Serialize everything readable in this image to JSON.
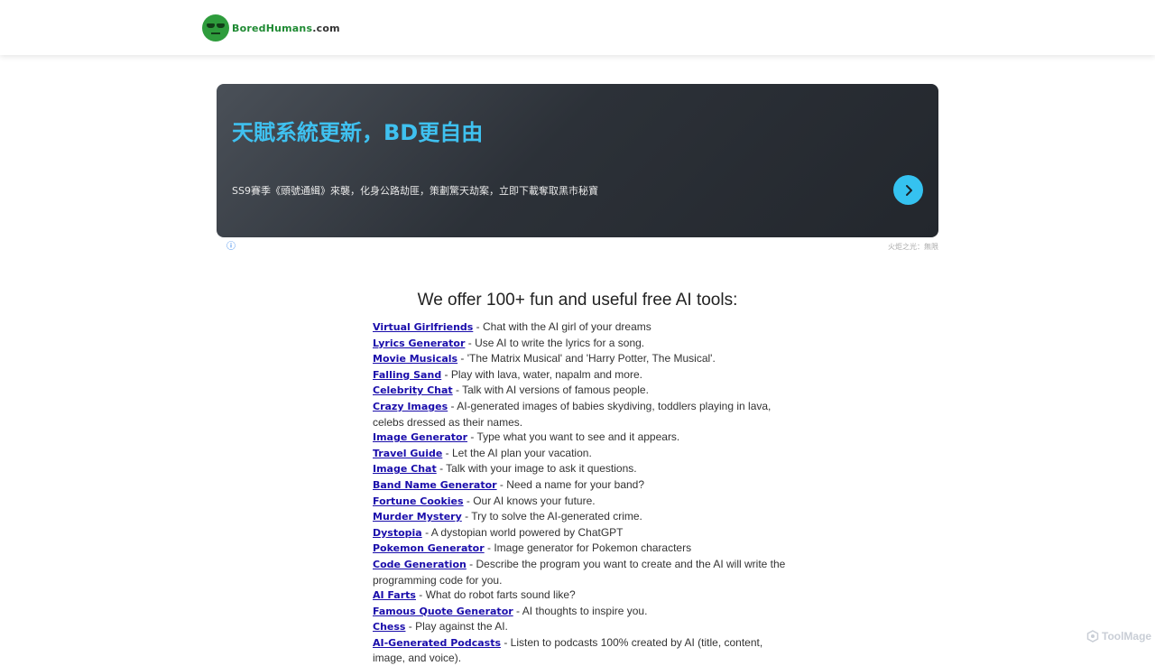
{
  "header": {
    "logo_name": "Bored",
    "logo_humans": "Humans",
    "logo_tld": ".com"
  },
  "ad": {
    "title": "天賦系統更新，BD更自由",
    "description": "SS9賽季《頭號通緝》來襲，化身公路劫匪，策劃驚天劫案，立即下載奪取黑市秘寶",
    "info_symbol": "ⓘ",
    "footer": "火炬之光：無限"
  },
  "main": {
    "headline": "We offer 100+ fun and useful free AI tools:",
    "tools": [
      {
        "name": "Virtual Girlfriends",
        "desc": " - Chat with the AI girl of your dreams"
      },
      {
        "name": "Lyrics Generator",
        "desc": " - Use AI to write the lyrics for a song."
      },
      {
        "name": "Movie Musicals",
        "desc": " - 'The Matrix Musical' and 'Harry Potter, The Musical'."
      },
      {
        "name": "Falling Sand",
        "desc": " - Play with lava, water, napalm and more."
      },
      {
        "name": "Celebrity Chat",
        "desc": " - Talk with AI versions of famous people."
      },
      {
        "name": "Crazy Images",
        "desc": " - AI-generated images of babies skydiving, toddlers playing in lava, celebs dressed as their names."
      },
      {
        "name": "Image Generator",
        "desc": " - Type what you want to see and it appears."
      },
      {
        "name": "Travel Guide",
        "desc": " - Let the AI plan your vacation."
      },
      {
        "name": "Image Chat",
        "desc": " - Talk with your image to ask it questions."
      },
      {
        "name": "Band Name Generator",
        "desc": " - Need a name for your band?"
      },
      {
        "name": "Fortune Cookies",
        "desc": " - Our AI knows your future."
      },
      {
        "name": "Murder Mystery",
        "desc": " - Try to solve the AI-generated crime."
      },
      {
        "name": "Dystopia",
        "desc": " - A dystopian world powered by ChatGPT"
      },
      {
        "name": "Pokemon Generator",
        "desc": " - Image generator for Pokemon characters"
      },
      {
        "name": "Code Generation",
        "desc": " - Describe the program you want to create and the AI will write the programming code for you."
      },
      {
        "name": "AI Farts",
        "desc": " - What do robot farts sound like?"
      },
      {
        "name": "Famous Quote Generator",
        "desc": " - AI thoughts to inspire you."
      },
      {
        "name": "Chess",
        "desc": " - Play against the AI."
      },
      {
        "name": "AI-Generated Podcasts",
        "desc": " - Listen to podcasts 100% created by AI (title, content, image, and voice)."
      }
    ]
  },
  "watermark": {
    "text": "ToolMage"
  },
  "colors": {
    "link": "#1a0dab",
    "brand_green": "#2e9c3c",
    "ad_accent": "#35c2f0"
  },
  "icons": {
    "logo": "green-smiley-face-icon",
    "ad_arrow": "chevron-right-icon",
    "ad_info": "info-icon",
    "watermark": "hexagon-logo-icon"
  }
}
